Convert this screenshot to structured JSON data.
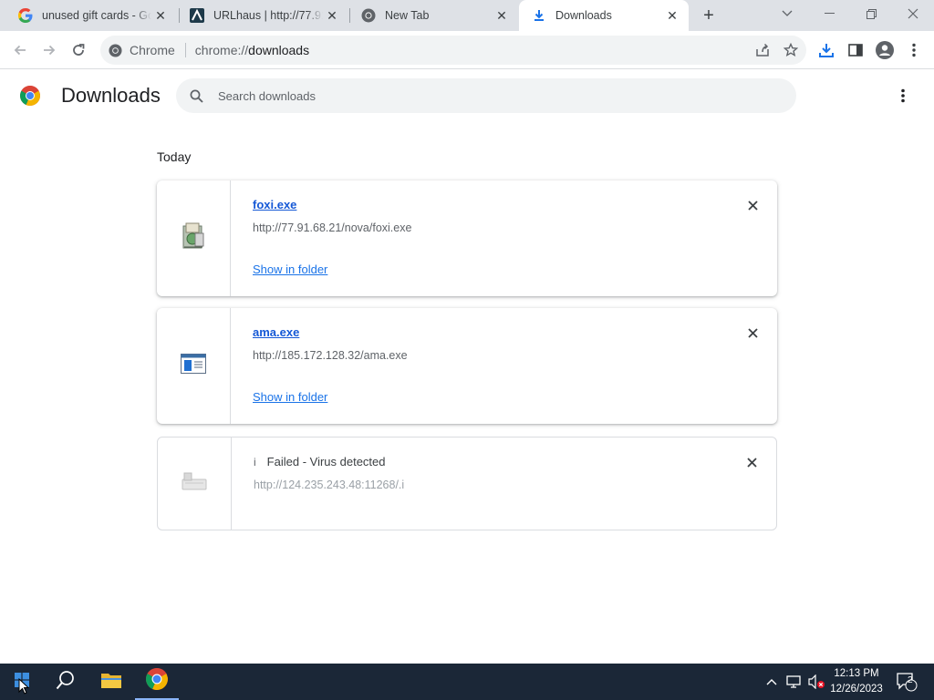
{
  "browser": {
    "tabs": [
      {
        "title": "unused gift cards - Goo",
        "icon": "google-g-icon"
      },
      {
        "title": "URLhaus | http://77.91.6",
        "icon": "urlhaus-icon"
      },
      {
        "title": "New Tab",
        "icon": "chrome-icon"
      },
      {
        "title": "Downloads",
        "icon": "download-icon",
        "active": true
      }
    ],
    "new_tab_icon": "plus-icon",
    "omnibox": {
      "site_label": "Chrome",
      "url_prefix": "chrome://",
      "url_path": "downloads"
    }
  },
  "page": {
    "title": "Downloads",
    "search": {
      "placeholder": "Search downloads",
      "value": ""
    },
    "section_label": "Today",
    "downloads": [
      {
        "filename": "foxi.exe",
        "url": "http://77.91.68.21/nova/foxi.exe",
        "action": "Show in folder",
        "icon": "installer-icon"
      },
      {
        "filename": "ama.exe",
        "url": "http://185.172.128.32/ama.exe",
        "action": "Show in folder",
        "icon": "exe-window-icon"
      },
      {
        "status_icon": "i",
        "status": "Failed - Virus detected",
        "url": "http://124.235.243.48:11268/.i",
        "icon": "generic-file-icon"
      }
    ]
  },
  "taskbar": {
    "time": "12:13 PM",
    "date": "12/26/2023",
    "notifications": "2"
  },
  "colors": {
    "accent": "#1a73e8",
    "tabstrip": "#dee1e6",
    "taskbar": "#1b2737"
  }
}
